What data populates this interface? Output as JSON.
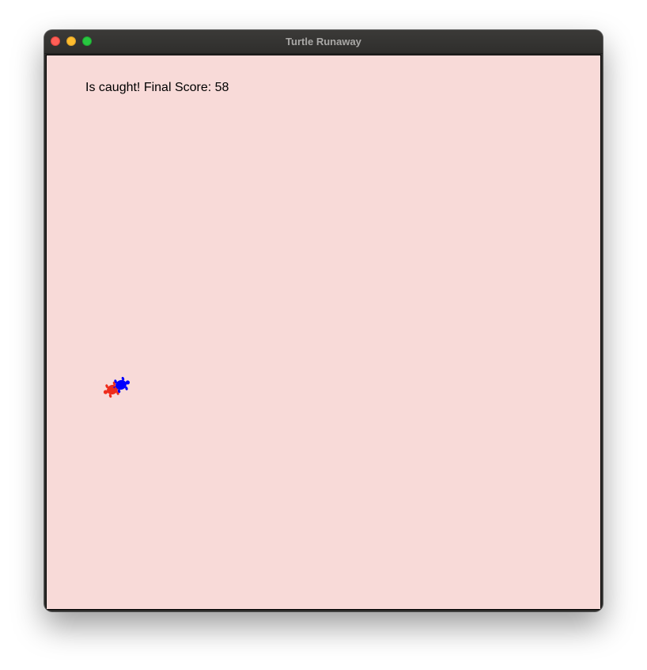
{
  "window": {
    "title": "Turtle Runaway",
    "controls": [
      "close",
      "minimize",
      "zoom"
    ]
  },
  "game": {
    "status_text": "Is caught! Final Score: 58",
    "background_color": "#f8dad8",
    "chaser": {
      "color": "#ee2c1c",
      "shape": "turtle"
    },
    "runner": {
      "color": "#0000ff",
      "shape": "turtle"
    }
  },
  "colors": {
    "close": "#ff5f57",
    "minimize": "#febc2e",
    "zoom": "#28c840"
  }
}
